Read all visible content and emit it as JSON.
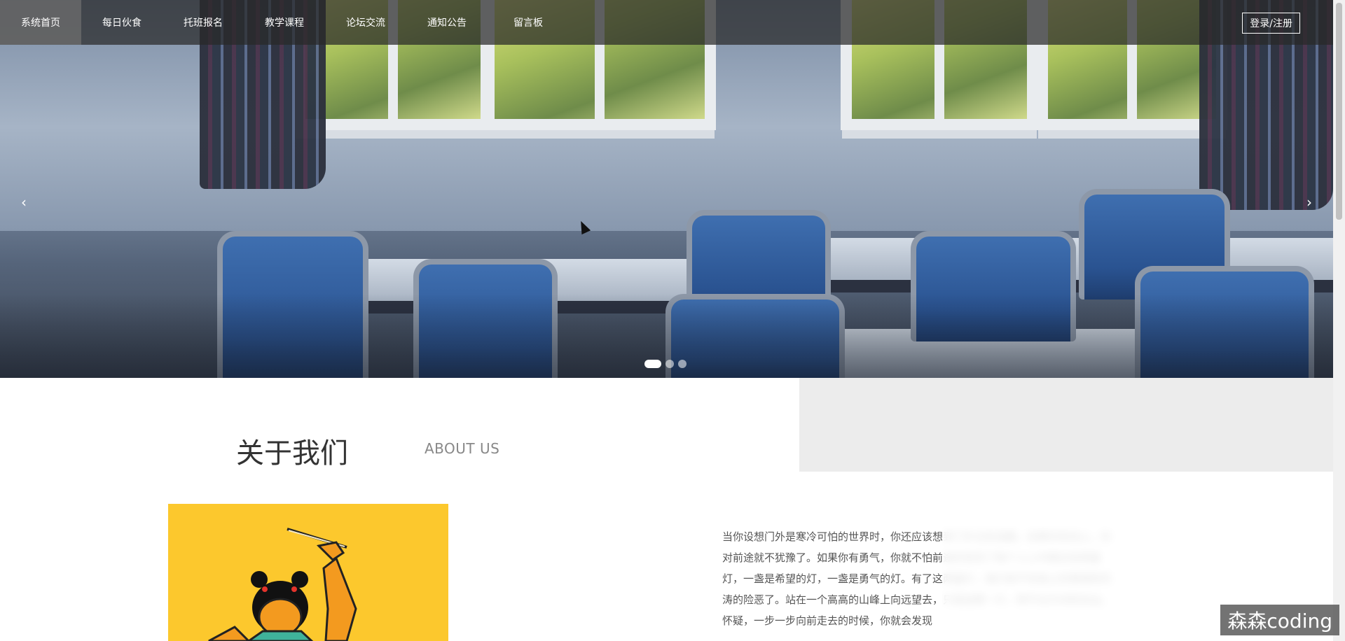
{
  "nav": {
    "items": [
      {
        "label": "系统首页",
        "active": true
      },
      {
        "label": "每日伙食",
        "active": false
      },
      {
        "label": "托班报名",
        "active": false
      },
      {
        "label": "教学课程",
        "active": false
      },
      {
        "label": "论坛交流",
        "active": false
      },
      {
        "label": "通知公告",
        "active": false
      },
      {
        "label": "留言板",
        "active": false
      }
    ],
    "login_label": "登录/注册"
  },
  "carousel": {
    "prev_icon": "‹",
    "next_icon": "›",
    "slide_count": 3,
    "active_slide": 1
  },
  "about": {
    "title": "关于我们",
    "subtitle": "ABOUT US",
    "text": "当你设想门外是寒冷可怕的世界时，你还应该想到门外也有温暖。如果你有信心，你对前途就不犹豫了。如果你有勇气，你就不怕前途的危险了每个人心中都应有两盏灯，一盏是希望的灯，一盏是勇气的灯。有了这两盏灯，我们就不怕海上的黑暗和风涛的险恶了。站在一个高高的山峰上向远望去，只是迷蒙一片，辨不出方向和吉凶。怀疑，一步一步向前走去的时候，你就会发现"
  },
  "watermark": "森森coding",
  "colors": {
    "nav_bg": "#282828",
    "accent_yellow": "#fcc82d",
    "about_gray": "#ececec"
  }
}
